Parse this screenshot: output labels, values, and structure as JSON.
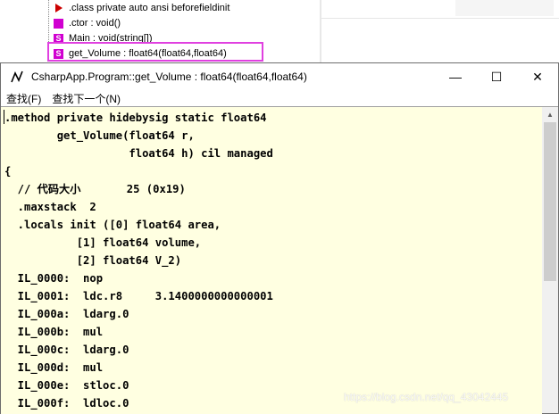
{
  "tree": {
    "items": [
      {
        "label": ".class private auto ansi beforefieldinit",
        "icon": "red-triangle-icon",
        "color": "#cc0000"
      },
      {
        "label": ".ctor : void()",
        "icon": "method-icon",
        "color": "#d000d0"
      },
      {
        "label": "Main : void(string[])",
        "icon": "static-method-icon",
        "color": "#d000d0"
      },
      {
        "label": "get_Volume : float64(float64,float64)",
        "icon": "static-method-icon",
        "color": "#d000d0"
      }
    ],
    "highlight_color": "#e040e0"
  },
  "window": {
    "title": "CsharpApp.Program::get_Volume : float64(float64,float64)",
    "minimize": "—",
    "maximize": "☐",
    "close": "✕"
  },
  "menu": {
    "find": "查找(F)",
    "find_next": "查找下一个(N)"
  },
  "code": {
    "lines": [
      ".method private hidebysig static float64",
      "        get_Volume(float64 r,",
      "                   float64 h) cil managed",
      "{",
      "  // 代码大小       25 (0x19)",
      "  .maxstack  2",
      "  .locals init ([0] float64 area,",
      "           [1] float64 volume,",
      "           [2] float64 V_2)",
      "  IL_0000:  nop",
      "  IL_0001:  ldc.r8     3.1400000000000001",
      "  IL_000a:  ldarg.0",
      "  IL_000b:  mul",
      "  IL_000c:  ldarg.0",
      "  IL_000d:  mul",
      "  IL_000e:  stloc.0",
      "  IL_000f:  ldloc.0"
    ],
    "background": "#ffffe1"
  },
  "watermark": "https://blog.csdn.net/qq_43042445"
}
